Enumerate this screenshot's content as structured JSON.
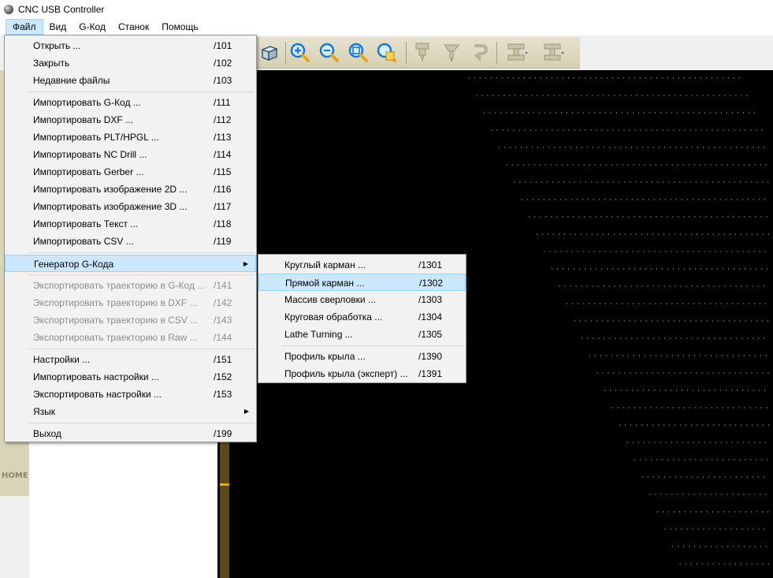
{
  "window": {
    "title": "CNC USB Controller"
  },
  "menubar": [
    "Файл",
    "Вид",
    "G-Код",
    "Станок",
    "Помощь"
  ],
  "file_menu": {
    "group1": [
      {
        "label": "Открыть ...",
        "shortcut": "/101"
      },
      {
        "label": "Закрыть",
        "shortcut": "/102"
      },
      {
        "label": "Недавние файлы",
        "shortcut": "/103"
      }
    ],
    "group2": [
      {
        "label": "Импортировать G-Код ...",
        "shortcut": "/111"
      },
      {
        "label": "Импортировать DXF ...",
        "shortcut": "/112"
      },
      {
        "label": "Импортировать PLT/HPGL ...",
        "shortcut": "/113"
      },
      {
        "label": "Импортировать NC Drill ...",
        "shortcut": "/114"
      },
      {
        "label": "Импортировать Gerber ...",
        "shortcut": "/115"
      },
      {
        "label": "Импортировать изображение 2D ...",
        "shortcut": "/116"
      },
      {
        "label": "Импортировать изображение 3D ...",
        "shortcut": "/117"
      },
      {
        "label": "Импортировать Текст ...",
        "shortcut": "/118"
      },
      {
        "label": "Импортировать CSV ...",
        "shortcut": "/119"
      }
    ],
    "generator": {
      "label": "Генератор G-Кода"
    },
    "group4": [
      {
        "label": "Экспортировать траекторию в G-Код ...",
        "shortcut": "/141"
      },
      {
        "label": "Экспортировать траекторию в DXF ...",
        "shortcut": "/142"
      },
      {
        "label": "Экспортировать траекторию в CSV ...",
        "shortcut": "/143"
      },
      {
        "label": "Экспортировать траекторию в Raw ...",
        "shortcut": "/144"
      }
    ],
    "group5": [
      {
        "label": "Настройки ...",
        "shortcut": "/151"
      },
      {
        "label": "Импортировать настройки ...",
        "shortcut": "/152"
      },
      {
        "label": "Экспортировать настройки ...",
        "shortcut": "/153"
      }
    ],
    "language": {
      "label": "Язык"
    },
    "exit": {
      "label": "Выход",
      "shortcut": "/199"
    }
  },
  "generator_submenu": {
    "group1": [
      {
        "label": "Круглый карман ...",
        "shortcut": "/1301"
      },
      {
        "label": "Прямой карман ...",
        "shortcut": "/1302"
      },
      {
        "label": "Массив сверловки ...",
        "shortcut": "/1303"
      },
      {
        "label": "Круговая обработка ...",
        "shortcut": "/1304"
      },
      {
        "label": "Lathe Turning ...",
        "shortcut": "/1305"
      }
    ],
    "group2": [
      {
        "label": "Профиль крыла ...",
        "shortcut": "/1390"
      },
      {
        "label": "Профиль крыла (эксперт) ...",
        "shortcut": "/1391"
      }
    ]
  },
  "side_panel": {
    "home_label": "HOME"
  },
  "colors": {
    "highlight": "#cce8ff",
    "highlight_border": "#99d1ff",
    "toolbar": "#dcd6bb",
    "canvas": "#000000"
  }
}
